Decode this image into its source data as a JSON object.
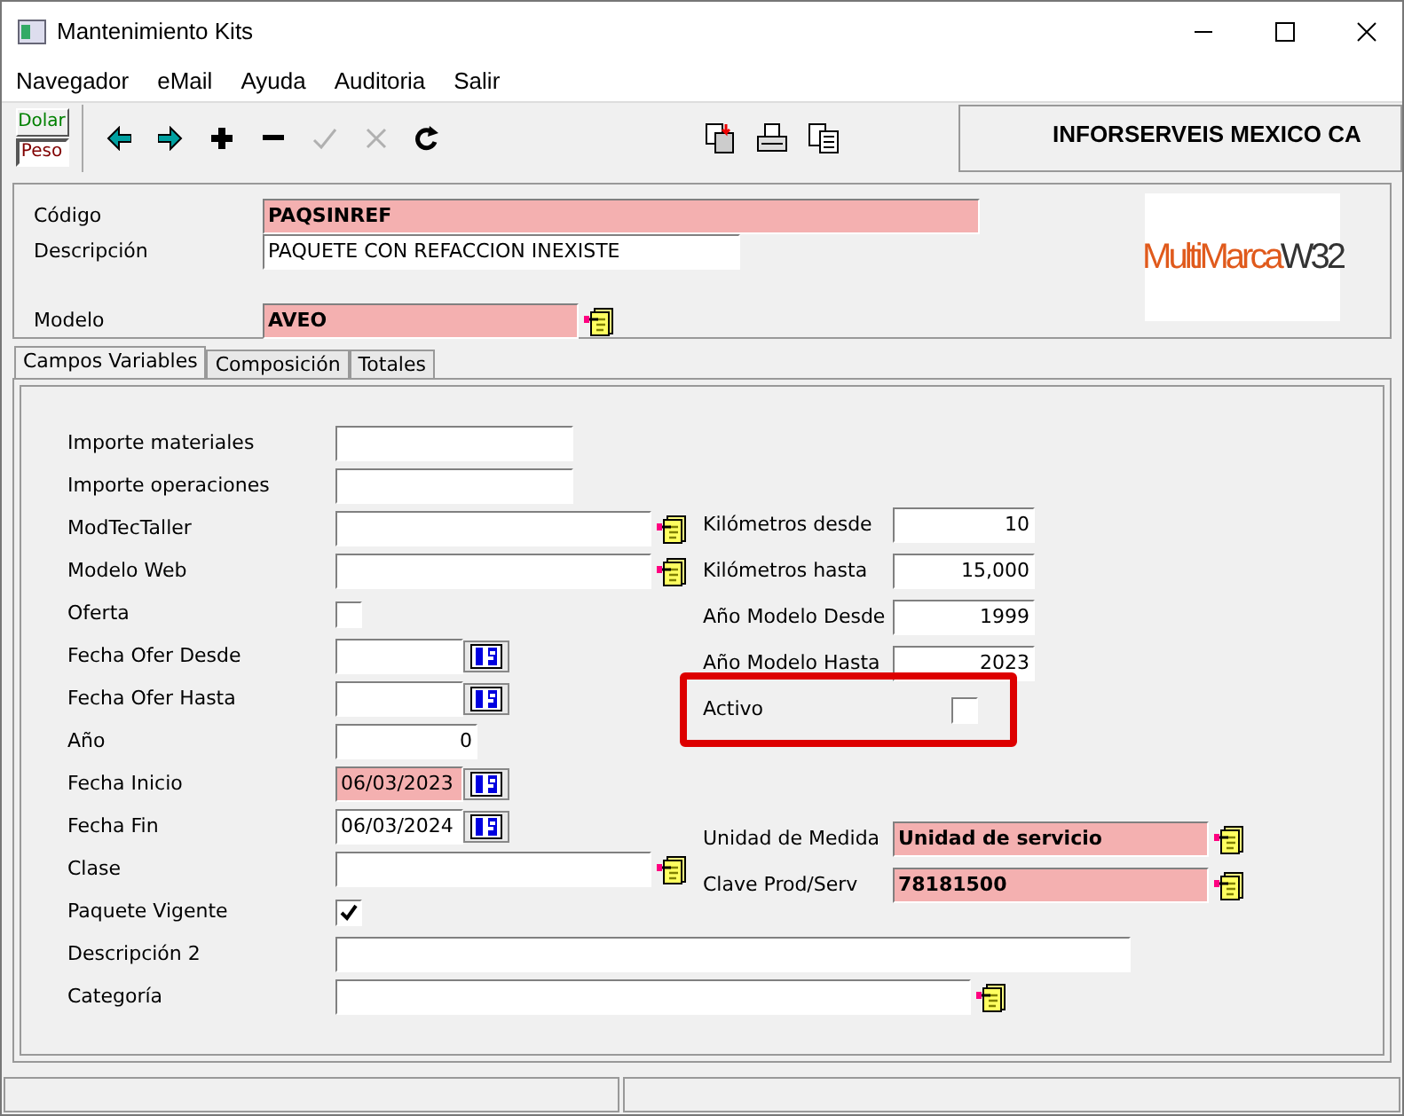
{
  "window": {
    "title": "Mantenimiento Kits"
  },
  "menu": [
    "Navegador",
    "eMail",
    "Ayuda",
    "Auditoria",
    "Salir"
  ],
  "currency": [
    {
      "label": "Dolar",
      "selected": false,
      "color": "#008000"
    },
    {
      "label": "Peso",
      "selected": true,
      "color": "#800000"
    }
  ],
  "toolbar": [
    {
      "kind": "prev",
      "disabled": false
    },
    {
      "kind": "next",
      "disabled": false
    },
    {
      "kind": "add",
      "disabled": false
    },
    {
      "kind": "remove",
      "disabled": false
    },
    {
      "kind": "accept",
      "disabled": true
    },
    {
      "kind": "cancel",
      "disabled": true
    },
    {
      "kind": "refresh",
      "disabled": false
    }
  ],
  "toolbar_right": [
    {
      "kind": "export"
    },
    {
      "kind": "print"
    },
    {
      "kind": "copy"
    }
  ],
  "company": "INFORSERVEIS MEXICO CA",
  "logo": {
    "text": "MultiMarca",
    "suffix": "W32"
  },
  "header_fields": [
    {
      "label": "Código",
      "value": "PAQSINREF",
      "required": true,
      "kind": "code"
    },
    {
      "label": "Descripción",
      "value": "PAQUETE CON REFACCION INEXISTE",
      "required": false,
      "kind": "desc"
    },
    {
      "label": "Modelo",
      "value": "AVEO",
      "required": true,
      "kind": "lookup"
    }
  ],
  "tabs": [
    {
      "label": "Campos Variables",
      "selected": true
    },
    {
      "label": "Composición",
      "selected": false
    },
    {
      "label": "Totales",
      "selected": false
    }
  ],
  "left_fields": [
    {
      "label": "Importe materiales",
      "kind": "short",
      "required": false
    },
    {
      "label": "Importe operaciones",
      "kind": "short",
      "required": false
    },
    {
      "label": "ModTecTaller",
      "kind": "lookup",
      "required": false
    },
    {
      "label": "Modelo Web",
      "kind": "lookup",
      "required": false
    },
    {
      "label": "Oferta",
      "kind": "check",
      "checked": false
    },
    {
      "label": "Fecha Ofer Desde",
      "kind": "date",
      "required": false
    },
    {
      "label": "Fecha Ofer Hasta",
      "kind": "date",
      "required": false
    },
    {
      "label": "Año",
      "kind": "number",
      "value": "0",
      "required": false
    },
    {
      "label": "Fecha Inicio",
      "kind": "date",
      "value": "06/03/2023",
      "required": true
    },
    {
      "label": "Fecha Fin",
      "kind": "date",
      "value": "06/03/2024",
      "required": false
    },
    {
      "label": "Clase",
      "kind": "lookup",
      "required": false
    },
    {
      "label": "Paquete Vigente",
      "kind": "check",
      "checked": true
    },
    {
      "label": "Descripción 2",
      "kind": "wide",
      "required": false
    },
    {
      "label": "Categoría",
      "kind": "wide_lookup",
      "required": false
    }
  ],
  "right_fields": [
    {
      "label": "Kilómetros desde",
      "kind": "number",
      "value": "10",
      "required": false
    },
    {
      "label": "Kilómetros hasta",
      "kind": "number",
      "value": "15,000",
      "required": false
    },
    {
      "label": "Año Modelo Desde",
      "kind": "number",
      "value": "1999",
      "required": false
    },
    {
      "label": "Año Modelo Hasta",
      "kind": "number",
      "value": "2023",
      "required": false
    },
    {
      "label": "Activo",
      "kind": "check",
      "checked": false,
      "highlighted": true
    }
  ],
  "lower_right_fields": [
    {
      "label": "Unidad de Medida",
      "kind": "lookup",
      "value": "Unidad de servicio",
      "required": true
    },
    {
      "label": "Clave Prod/Serv",
      "kind": "lookup",
      "value": "78181500",
      "required": true
    }
  ]
}
